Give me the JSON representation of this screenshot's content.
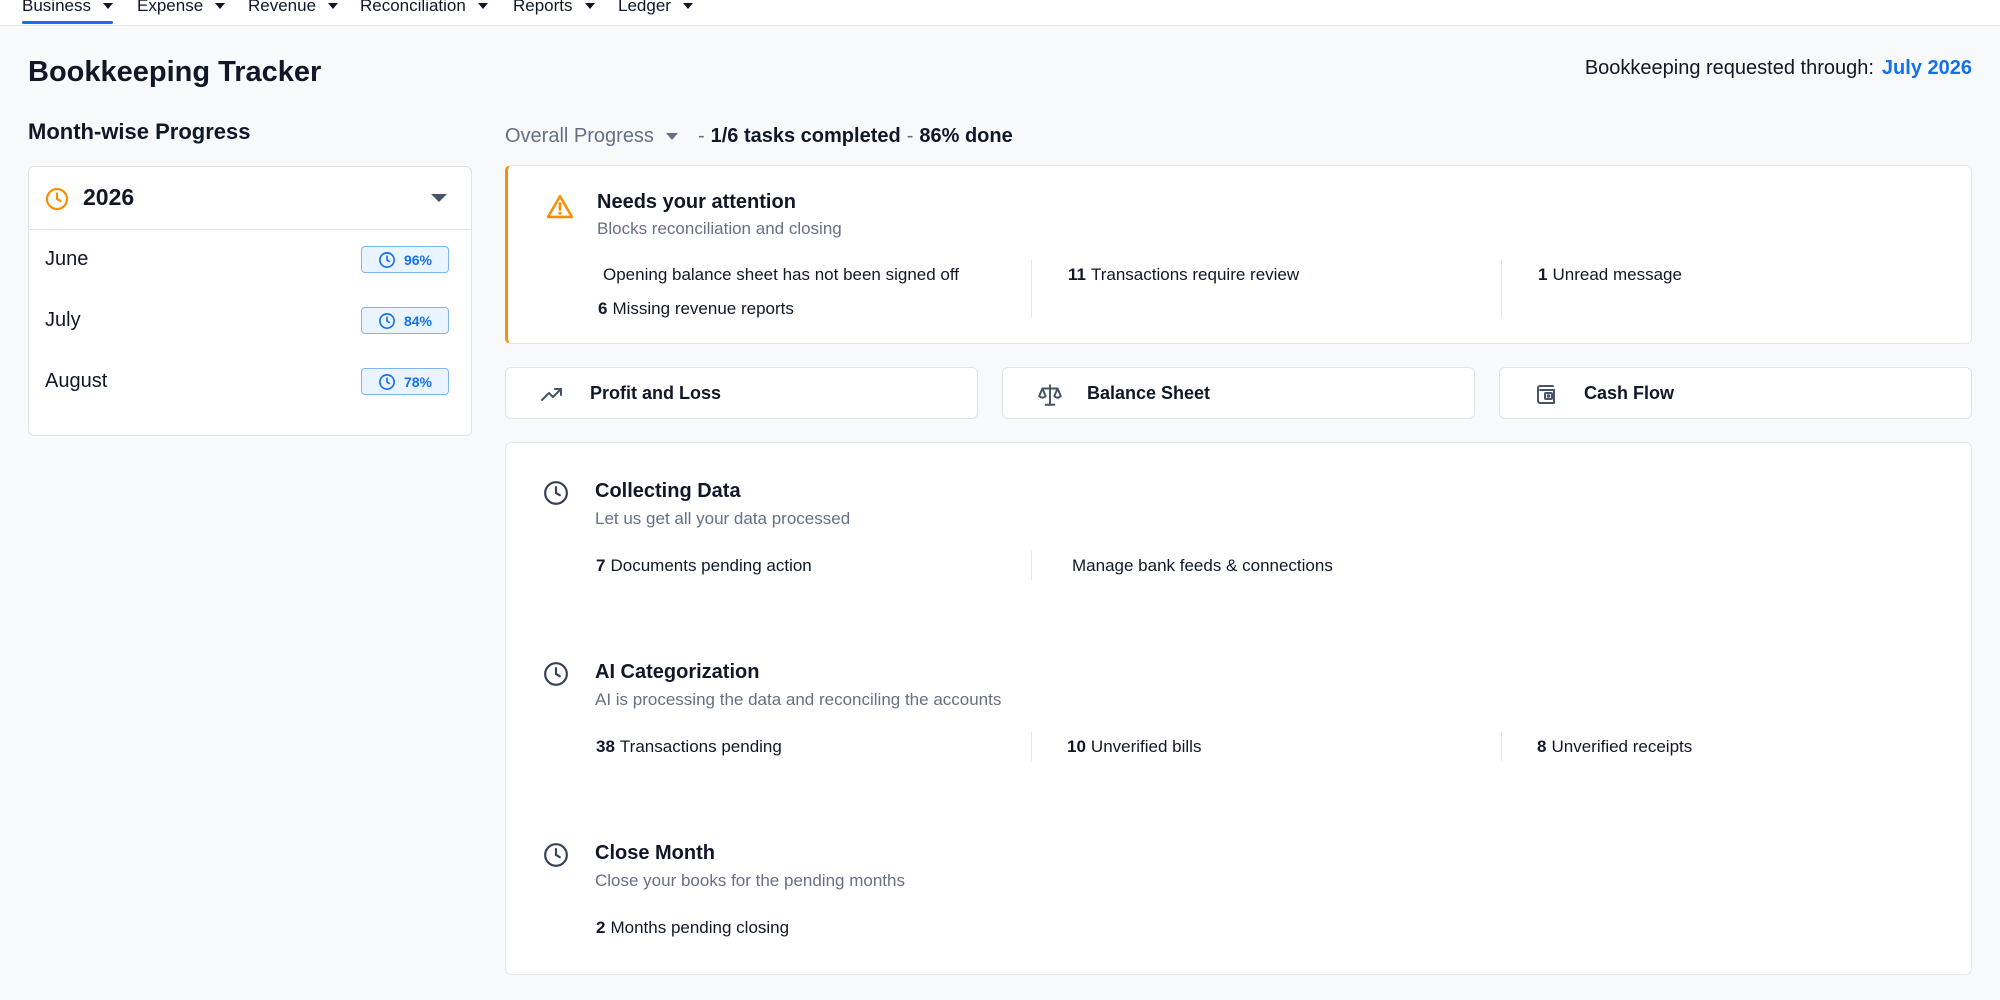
{
  "nav": {
    "tabs": [
      {
        "label": "Business",
        "active": true
      },
      {
        "label": "Expense"
      },
      {
        "label": "Revenue"
      },
      {
        "label": "Reconciliation"
      },
      {
        "label": "Reports"
      },
      {
        "label": "Ledger"
      }
    ]
  },
  "header": {
    "title": "Bookkeeping Tracker",
    "requested_label": "Bookkeeping requested through:",
    "requested_value": "July 2026"
  },
  "month_wise": {
    "title": "Month-wise Progress",
    "year": "2026",
    "months": [
      {
        "name": "June",
        "percent": "96%"
      },
      {
        "name": "July",
        "percent": "84%"
      },
      {
        "name": "August",
        "percent": "78%"
      }
    ]
  },
  "overall": {
    "label": "Overall Progress",
    "sep": "-",
    "tasks": "1/6 tasks completed",
    "done": "86% done"
  },
  "attention": {
    "title": "Needs your attention",
    "subtitle": "Blocks reconciliation and closing",
    "items": [
      {
        "count": "",
        "text": "Opening balance sheet has not been signed off"
      },
      {
        "count": "6",
        "text": "Missing revenue reports"
      },
      {
        "count": "11",
        "text": "Transactions require review"
      },
      {
        "count": "1",
        "text": "Unread message"
      }
    ]
  },
  "reports": [
    {
      "label": "Profit and Loss",
      "icon": "trending-up-icon"
    },
    {
      "label": "Balance Sheet",
      "icon": "scale-icon"
    },
    {
      "label": "Cash Flow",
      "icon": "wallet-icon"
    }
  ],
  "steps": [
    {
      "title": "Collecting Data",
      "subtitle": "Let us get all your data processed",
      "stats": [
        {
          "count": "7",
          "text": "Documents pending action"
        },
        {
          "count": "",
          "text": "Manage bank feeds & connections"
        }
      ]
    },
    {
      "title": "AI Categorization",
      "subtitle": "AI is processing the data and reconciling the accounts",
      "stats": [
        {
          "count": "38",
          "text": "Transactions pending"
        },
        {
          "count": "10",
          "text": "Unverified bills"
        },
        {
          "count": "8",
          "text": "Unverified receipts"
        }
      ]
    },
    {
      "title": "Close Month",
      "subtitle": "Close your books for the pending months",
      "stats": [
        {
          "count": "2",
          "text": "Months pending closing"
        }
      ]
    }
  ],
  "colors": {
    "accent": "#1570ef",
    "warning": "#f79009",
    "muted": "#667085",
    "border": "#e4e7ec"
  }
}
